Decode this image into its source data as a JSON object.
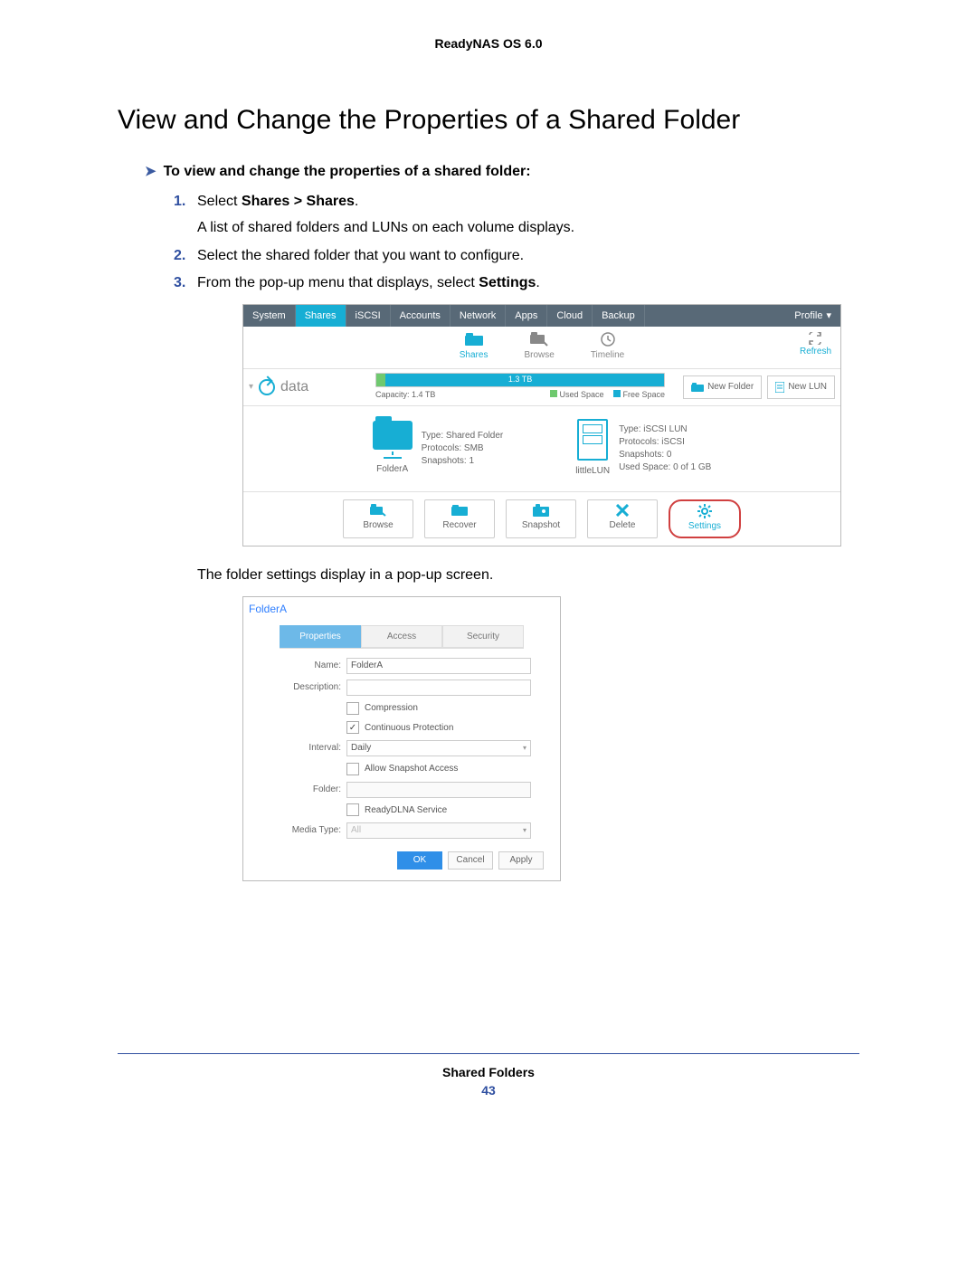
{
  "doc": {
    "header": "ReadyNAS OS 6.0",
    "title": "View and Change the Properties of a Shared Folder",
    "lead": "To view and change the properties of a shared folder:",
    "steps": {
      "s1a": "Select ",
      "s1b": "Shares > Shares",
      "s1c": ".",
      "s1_sub": "A list of shared folders and LUNs on each volume displays.",
      "s2": "Select the shared folder that you want to configure.",
      "s3a": "From the pop-up menu that displays, select ",
      "s3b": "Settings",
      "s3c": ".",
      "after1": "The folder settings display in a pop-up screen."
    },
    "footer_chapter": "Shared Folders",
    "footer_page": "43"
  },
  "shot1": {
    "nav": [
      "System",
      "Shares",
      "iSCSI",
      "Accounts",
      "Network",
      "Apps",
      "Cloud",
      "Backup"
    ],
    "nav_active_index": 1,
    "profile": "Profile",
    "toolbar": {
      "shares": "Shares",
      "browse": "Browse",
      "timeline": "Timeline",
      "refresh": "Refresh"
    },
    "volume": {
      "name": "data",
      "bar_label": "1.3 TB",
      "capacity_label": "Capacity: 1.4 TB",
      "legend_used": "Used Space",
      "legend_free": "Free Space",
      "new_folder": "New Folder",
      "new_lun": "New LUN"
    },
    "folder": {
      "name": "FolderA",
      "meta1": "Type: Shared Folder",
      "meta2": "Protocols: SMB",
      "meta3": "Snapshots: 1"
    },
    "lun": {
      "name": "littleLUN",
      "meta1": "Type: iSCSI LUN",
      "meta2": "Protocols: iSCSI",
      "meta3": "Snapshots: 0",
      "meta4": "Used Space: 0 of 1 GB"
    },
    "actions": {
      "browse": "Browse",
      "recover": "Recover",
      "snapshot": "Snapshot",
      "delete": "Delete",
      "settings": "Settings"
    }
  },
  "shot2": {
    "title": "FolderA",
    "tabs": {
      "properties": "Properties",
      "access": "Access",
      "security": "Security"
    },
    "labels": {
      "name": "Name:",
      "description": "Description:",
      "compression": "Compression",
      "continuous": "Continuous Protection",
      "interval": "Interval:",
      "allow_snap": "Allow Snapshot Access",
      "folder": "Folder:",
      "readydlna": "ReadyDLNA Service",
      "media_type": "Media Type:"
    },
    "values": {
      "name": "FolderA",
      "interval": "Daily",
      "media_type": "All"
    },
    "buttons": {
      "ok": "OK",
      "cancel": "Cancel",
      "apply": "Apply"
    }
  }
}
